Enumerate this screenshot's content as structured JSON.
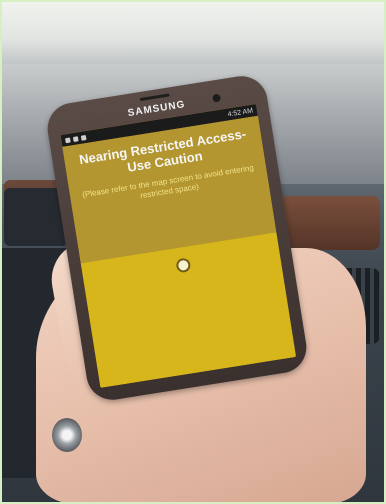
{
  "device": {
    "brand": "SAMSUNG",
    "status_time": "4:52 AM"
  },
  "alert": {
    "title": "Nearing Restricted Access-Use Caution",
    "message": "(Please refer to the map screen to avoid entering restricted space)"
  },
  "map": {
    "marker_icon": "location-dot-icon"
  },
  "colors": {
    "alert_background": "#b3962f",
    "map_background": "#d7b61b",
    "title_text": "#f6f6f6",
    "message_text": "#f2e38a"
  }
}
